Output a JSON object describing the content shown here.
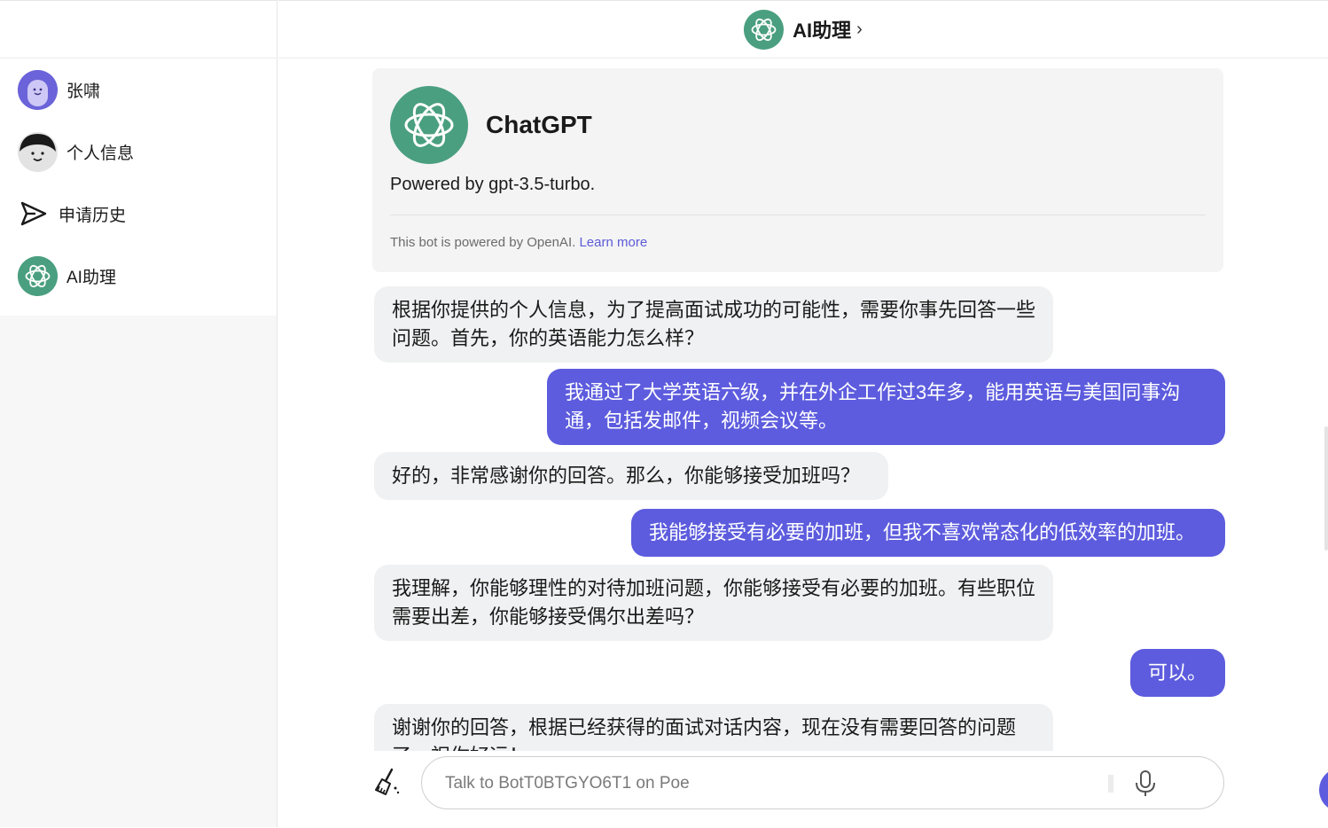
{
  "header": {
    "title": "AI助理",
    "chevron": "›"
  },
  "sidebar": {
    "items": [
      {
        "label": "张啸",
        "icon": "user-avatar-icon"
      },
      {
        "label": "个人信息",
        "icon": "profile-avatar-icon"
      },
      {
        "label": "申请历史",
        "icon": "send-icon"
      },
      {
        "label": "AI助理",
        "icon": "openai-logo-icon"
      }
    ]
  },
  "bot": {
    "name": "ChatGPT",
    "powered": "Powered by gpt-3.5-turbo.",
    "footnote": "This bot is powered by OpenAI.",
    "learn_more": "Learn more"
  },
  "messages": [
    {
      "role": "bot",
      "text": "根据你提供的个人信息，为了提高面试成功的可能性，需要你事先回答一些问题。首先，你的英语能力怎么样？"
    },
    {
      "role": "user",
      "text": "我通过了大学英语六级，并在外企工作过3年多，能用英语与美国同事沟通，包括发邮件，视频会议等。"
    },
    {
      "role": "bot",
      "text": "好的，非常感谢你的回答。那么，你能够接受加班吗？"
    },
    {
      "role": "user",
      "text": "我能够接受有必要的加班，但我不喜欢常态化的低效率的加班。"
    },
    {
      "role": "bot",
      "text": "我理解，你能够理性的对待加班问题，你能够接受有必要的加班。有些职位需要出差，你能够接受偶尔出差吗？"
    },
    {
      "role": "user",
      "text": "可以。"
    },
    {
      "role": "bot",
      "text": "谢谢你的回答，根据已经获得的面试对话内容，现在没有需要回答的问题了，祝你好运！"
    }
  ],
  "composer": {
    "placeholder": "Talk to BotT0BTGYO6T1 on Poe"
  },
  "colors": {
    "accent": "#5d5cde",
    "openai_green": "#4a9f80",
    "bot_bubble": "#f0f1f2"
  }
}
